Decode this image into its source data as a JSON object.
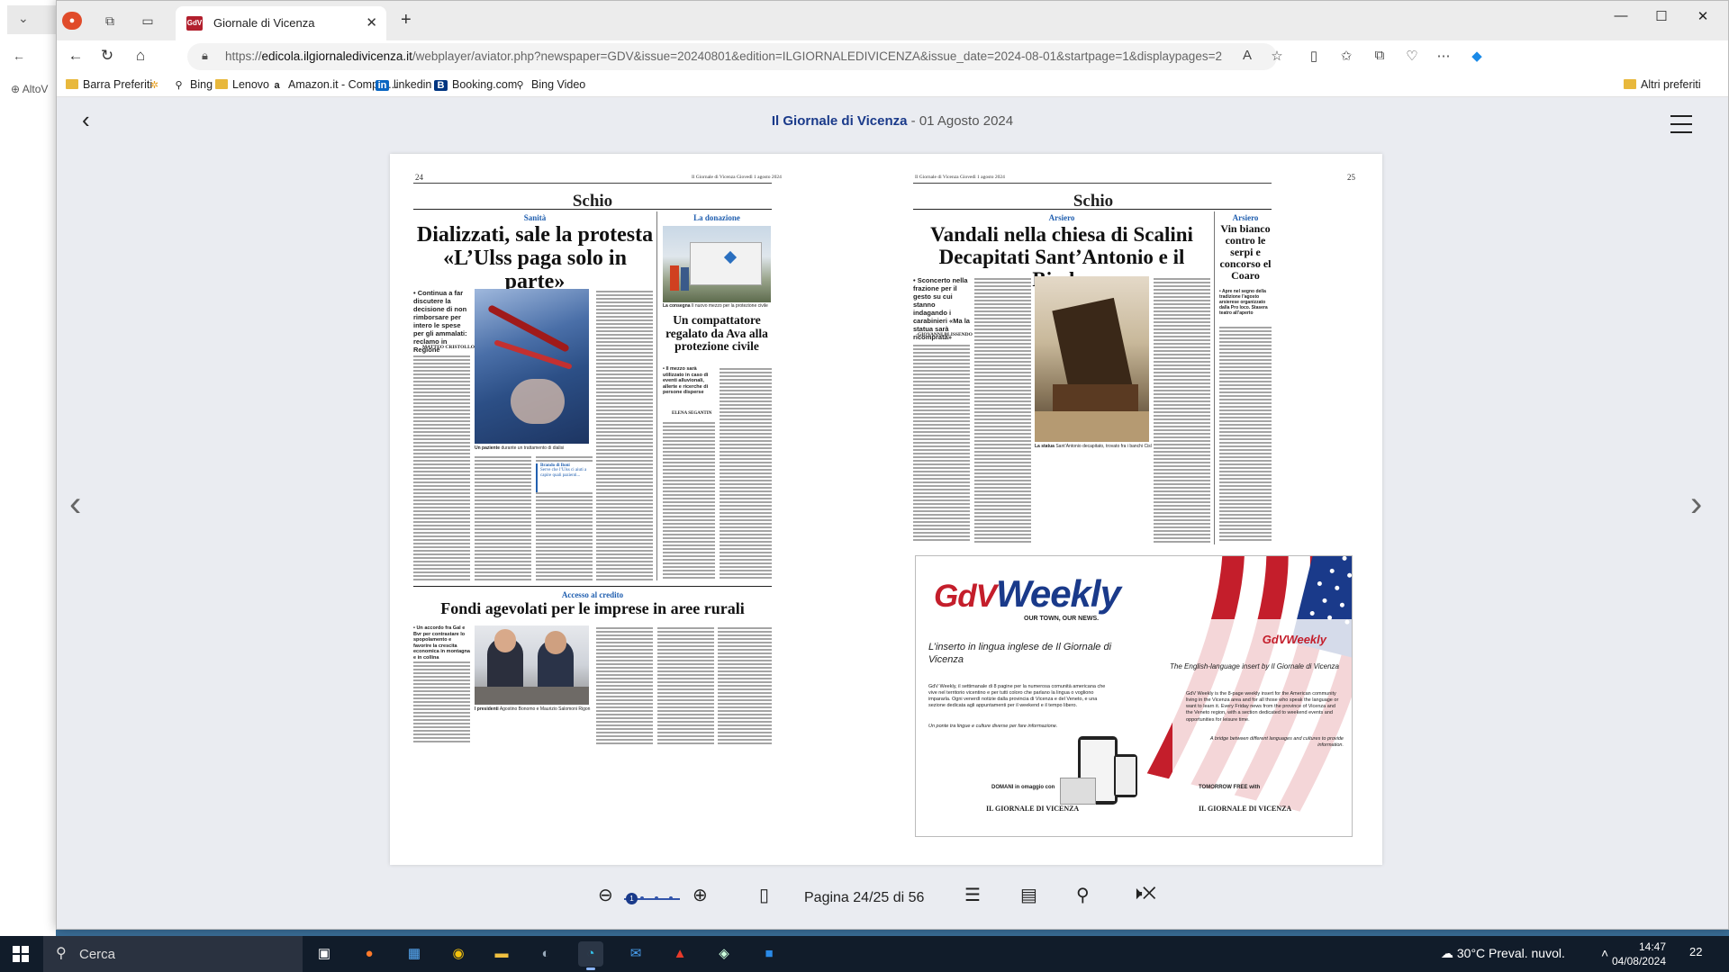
{
  "background": {
    "bookmark_label": "AltoV"
  },
  "browser": {
    "tab_title": "Giornale di Vicenza",
    "tab_favicon": "GdV",
    "url_prefix": "https://",
    "url_domain": "edicola.ilgiornaledivicenza.it",
    "url_path": "/webplayer/aviator.php?newspaper=GDV&issue=20240801&edition=ILGIORNALEDIVICENZA&issue_date=2024-08-01&startpage=1&displaypages=2"
  },
  "bookmarks": [
    "Barra Preferiti",
    "Bing",
    "Lenovo",
    "Amazon.it - Compra...",
    "linkedin",
    "Booking.com",
    "Bing Video",
    "Altri preferiti"
  ],
  "viewer": {
    "paper_name": "Il Giornale di Vicenza",
    "issue_date": "- 01 Agosto 2024",
    "zoom_level": "1",
    "page_indicator": "Pagina 24/25 di 56"
  },
  "pages": {
    "left": {
      "number": "24",
      "running_head": "Il Giornale di Vicenza Giovedì 1 agosto 2024",
      "section": "Schio",
      "main": {
        "kicker": "Sanità",
        "headline": "Dializzati, sale la protesta «L’Ulss paga solo in parte»",
        "summary": "• Continua a far discutere la decisione di non rimborsare per intero le spese per gli ammalati: reclamo in Regione",
        "byline": "MATTEO CRISTOLLO",
        "caption_lead": "Un paziente",
        "caption_text": "durante un trattamento di dialisi",
        "quote_label": "Brando di Boni",
        "quote_text": "Serve che l’Ulss ci aiuti a capire quali pazienti..."
      },
      "side": {
        "kicker": "La donazione",
        "caption_lead": "La consegna",
        "caption_text": "Il nuovo mezzo per la protezione civile",
        "headline": "Un compattatore regalato da Ava alla protezione civile",
        "summary": "• Il mezzo sarà utilizzato in caso di eventi alluvionali, allerte e ricerche di persone disperse",
        "byline": "ELENA SEGANTIN"
      },
      "bottom": {
        "kicker": "Accesso al credito",
        "headline": "Fondi agevolati per le imprese in aree rurali",
        "summary": "• Un accordo fra Gal e Bvr per contrastare lo spopolamento e favorire la crescita economica in montagna e in collina",
        "caption_lead": "I presidenti",
        "caption_text": "Agostino Bonomo e Maurizio Salomoni Rigon"
      }
    },
    "right": {
      "number": "25",
      "running_head": "Il Giornale di Vicenza Giovedì 1 agosto 2024",
      "section": "Schio",
      "main": {
        "kicker": "Arsiero",
        "headline": "Vandali nella chiesa di Scalini Decapitati Sant’Antonio e il Bimbo",
        "summary": "• Sconcerto nella frazione per il gesto su cui stanno indagando i carabinieri «Ma la statua sarà ricomprata»",
        "byline": "GIOVANNI BLISSENDO",
        "caption_lead": "La statua",
        "caption_text": "Sant’Antonio decapitato, trovato fra i banchi Cisl"
      },
      "side": {
        "kicker": "Arsiero",
        "headline": "Vin bianco contro le serpi e concorso el Coaro",
        "summary": "• Apre nel segno della tradizione l’agosto arsierese organizzato dalla Pro loco. Stasera teatro all’aperto"
      }
    }
  },
  "advert": {
    "logo_gdv": "GdV",
    "logo_weekly": "Weekly",
    "tagline": "OUR TOWN, OUR NEWS.",
    "insert_it": "L’inserto in lingua inglese de Il Giornale di Vicenza",
    "desc_it": "GdV Weekly, il settimanale di 8 pagine per la numerosa comunità americana che vive nel territorio vicentino e per tutti coloro che parlano la lingua o vogliono impararla. Ogni venerdì notizie dalla provincia di Vicenza e del Veneto, e una sezione dedicata agli appuntamenti per il weekend e il tempo libero.",
    "bridge_it": "Un ponte tra lingue e culture diverse per fare informazione.",
    "logo_small": "GdVWeekly",
    "insert_en": "The English-language insert by Il Giornale di Vicenza",
    "desc_en": "GdV Weekly is the 8-page weekly insert for the American community living in the Vicenza area and for all those who speak the language or want to learn it. Every Friday news from the province of Vicenza and the Veneto region, with a section dedicated to weekend events and opportunities for leisure time.",
    "bridge_en": "A bridge between different languages and cultures to provide information.",
    "domani": "DOMANI in omaggio con",
    "paper_it": "IL GIORNALE DI VICENZA",
    "tomorrow": "TOMORROW FREE with",
    "paper_en": "IL GIORNALE DI VICENZA"
  },
  "taskbar": {
    "search_placeholder": "Cerca",
    "weather": "30°C Preval. nuvol.",
    "time": "14:47",
    "date": "04/08/2024",
    "notifications": "22"
  }
}
